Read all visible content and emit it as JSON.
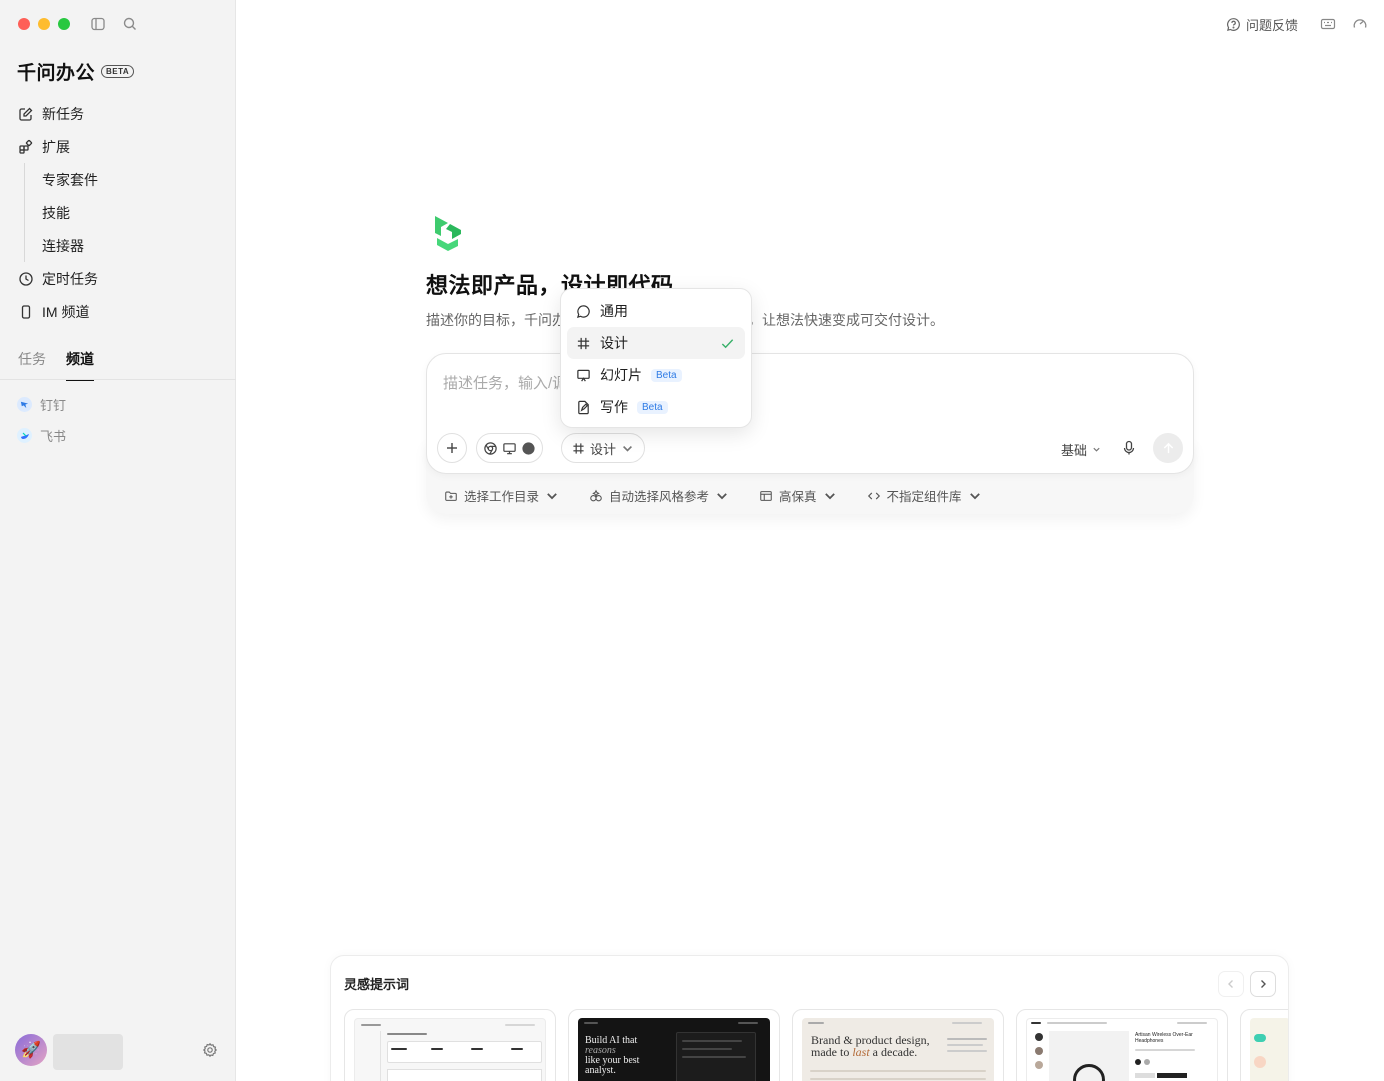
{
  "app": {
    "name": "千问办公",
    "beta_badge": "BETA"
  },
  "sidebar": {
    "nav": [
      {
        "label": "新任务",
        "icon": "edit-icon"
      },
      {
        "label": "扩展",
        "icon": "extension-icon"
      }
    ],
    "extension_items": [
      "专家套件",
      "技能",
      "连接器"
    ],
    "nav_after": [
      {
        "label": "定时任务",
        "icon": "clock-icon"
      },
      {
        "label": "IM 频道",
        "icon": "phone-icon"
      }
    ],
    "tabs": [
      {
        "label": "任务",
        "active": false
      },
      {
        "label": "频道",
        "active": true
      }
    ],
    "channels": [
      {
        "label": "钉钉",
        "icon": "dingtalk-icon"
      },
      {
        "label": "飞书",
        "icon": "feishu-icon"
      }
    ]
  },
  "topbar": {
    "feedback": "问题反馈"
  },
  "hero": {
    "headline": "想法即产品，设计即代码",
    "subline": "描述你的目标，千问办公将为你生成设计并同步预览，让想法快速变成可交付设计。"
  },
  "composer": {
    "placeholder": "描述任务，输入/调用技能",
    "mode_label": "设计",
    "base_label": "基础"
  },
  "options": [
    {
      "label": "选择工作目录",
      "icon": "folder-plus-icon"
    },
    {
      "label": "自动选择风格参考",
      "icon": "style-icon"
    },
    {
      "label": "高保真",
      "icon": "layout-icon"
    },
    {
      "label": "不指定组件库",
      "icon": "code-icon"
    }
  ],
  "dropdown": {
    "items": [
      {
        "label": "通用",
        "icon": "chat-icon",
        "beta": "",
        "selected": false
      },
      {
        "label": "设计",
        "icon": "hash-icon",
        "beta": "",
        "selected": true
      },
      {
        "label": "幻灯片",
        "icon": "slides-icon",
        "beta": "Beta",
        "selected": false
      },
      {
        "label": "写作",
        "icon": "write-icon",
        "beta": "Beta",
        "selected": false
      }
    ]
  },
  "inspiration": {
    "title": "灵感提示词",
    "cards": [
      {
        "text": ""
      },
      {
        "text_line1": "Build AI that",
        "text_line2": "reasons",
        "text_line3": "like your best",
        "text_line4": "analyst."
      },
      {
        "text_line1": "Brand & product design,",
        "text_line2_a": "made to ",
        "text_line2_b": "last",
        "text_line2_c": " a decade."
      },
      {
        "text": "Artisan Wireless Over-Ear Headphones"
      }
    ]
  },
  "colors": {
    "accent_green": "#38b069",
    "beta_blue": "#2f7be5",
    "sidebar_bg": "#f3f3f3"
  }
}
